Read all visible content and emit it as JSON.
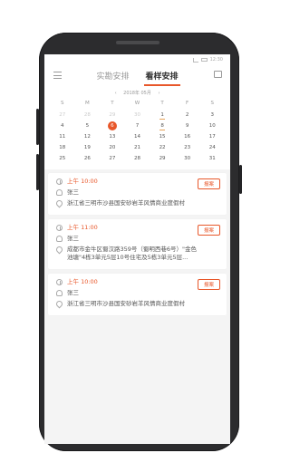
{
  "statusbar": {
    "time": "12:30"
  },
  "header": {
    "tabs": [
      {
        "label": "实勘安排"
      },
      {
        "label": "看样安排"
      }
    ]
  },
  "calendar": {
    "month_label": "2018年 05月",
    "prev_glyph": "‹",
    "next_glyph": "›",
    "weekdays": [
      "S",
      "M",
      "T",
      "W",
      "T",
      "F",
      "S"
    ],
    "days": [
      {
        "d": "27",
        "muted": true
      },
      {
        "d": "28",
        "muted": true
      },
      {
        "d": "29",
        "muted": true
      },
      {
        "d": "30",
        "muted": true
      },
      {
        "d": "1",
        "marked": true
      },
      {
        "d": "2"
      },
      {
        "d": "3"
      },
      {
        "d": "4"
      },
      {
        "d": "5"
      },
      {
        "d": "6",
        "today": true
      },
      {
        "d": "7"
      },
      {
        "d": "8",
        "marked": true
      },
      {
        "d": "9"
      },
      {
        "d": "10"
      },
      {
        "d": "11"
      },
      {
        "d": "12"
      },
      {
        "d": "13"
      },
      {
        "d": "14"
      },
      {
        "d": "15"
      },
      {
        "d": "16"
      },
      {
        "d": "17"
      },
      {
        "d": "18"
      },
      {
        "d": "19"
      },
      {
        "d": "20"
      },
      {
        "d": "21"
      },
      {
        "d": "22"
      },
      {
        "d": "23"
      },
      {
        "d": "24"
      },
      {
        "d": "25"
      },
      {
        "d": "26"
      },
      {
        "d": "27"
      },
      {
        "d": "28"
      },
      {
        "d": "29"
      },
      {
        "d": "30"
      },
      {
        "d": "31"
      }
    ]
  },
  "appointments": [
    {
      "time": "上午 10:00",
      "name": "张三",
      "address": "浙江省三明市沙县国安砂岩羊风情商业度假村",
      "tag": "报案"
    },
    {
      "time": "上午 11:00",
      "name": "张三",
      "address": "成都市金牛区蜀汉路359号（蜀明西巷6号）\"金色池塘\"4栋3单元5层10号住宅及5栋3单元5层...",
      "tag": "报案"
    },
    {
      "time": "上午 10:00",
      "name": "张三",
      "address": "浙江省三明市沙县国安砂岩羊风情商业度假村",
      "tag": "报案"
    }
  ],
  "colors": {
    "accent": "#e8572a",
    "phone_body": "#2c2c2e",
    "screen_bg": "#f4f4f4"
  }
}
